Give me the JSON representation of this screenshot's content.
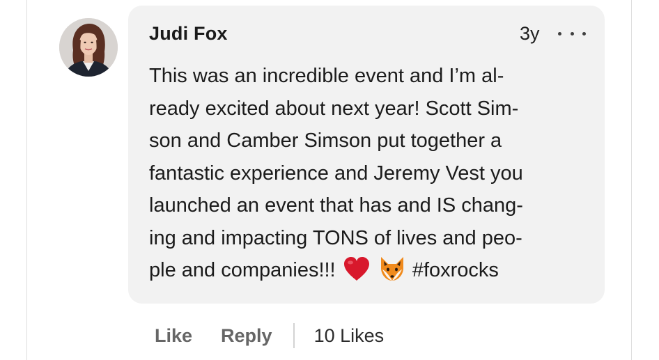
{
  "comment": {
    "author": "Judi Fox",
    "timestamp": "3y",
    "more_icon": "more-horizontal-icon",
    "body_lines": [
      "This was an incredible event and I’m al-",
      "ready excited about next year! Scott Sim-",
      "son and Camber Simson put together a",
      "fantastic experience and Jeremy Vest you",
      "launched an event that has and IS chang-",
      "ing and impacting TONS of lives and peo-"
    ],
    "last_line_text": "ple and companies!!!",
    "emoji_heart": "heart-emoji",
    "emoji_fox": "fox-emoji",
    "hashtag": "#foxrocks"
  },
  "actions": {
    "like_label": "Like",
    "reply_label": "Reply",
    "likes_count": "10 Likes"
  },
  "colors": {
    "bubble_bg": "#f2f2f2",
    "text": "#1b1b1b",
    "muted_action": "#666666",
    "heart": "#d8182c",
    "fox": "#f08a1c"
  }
}
